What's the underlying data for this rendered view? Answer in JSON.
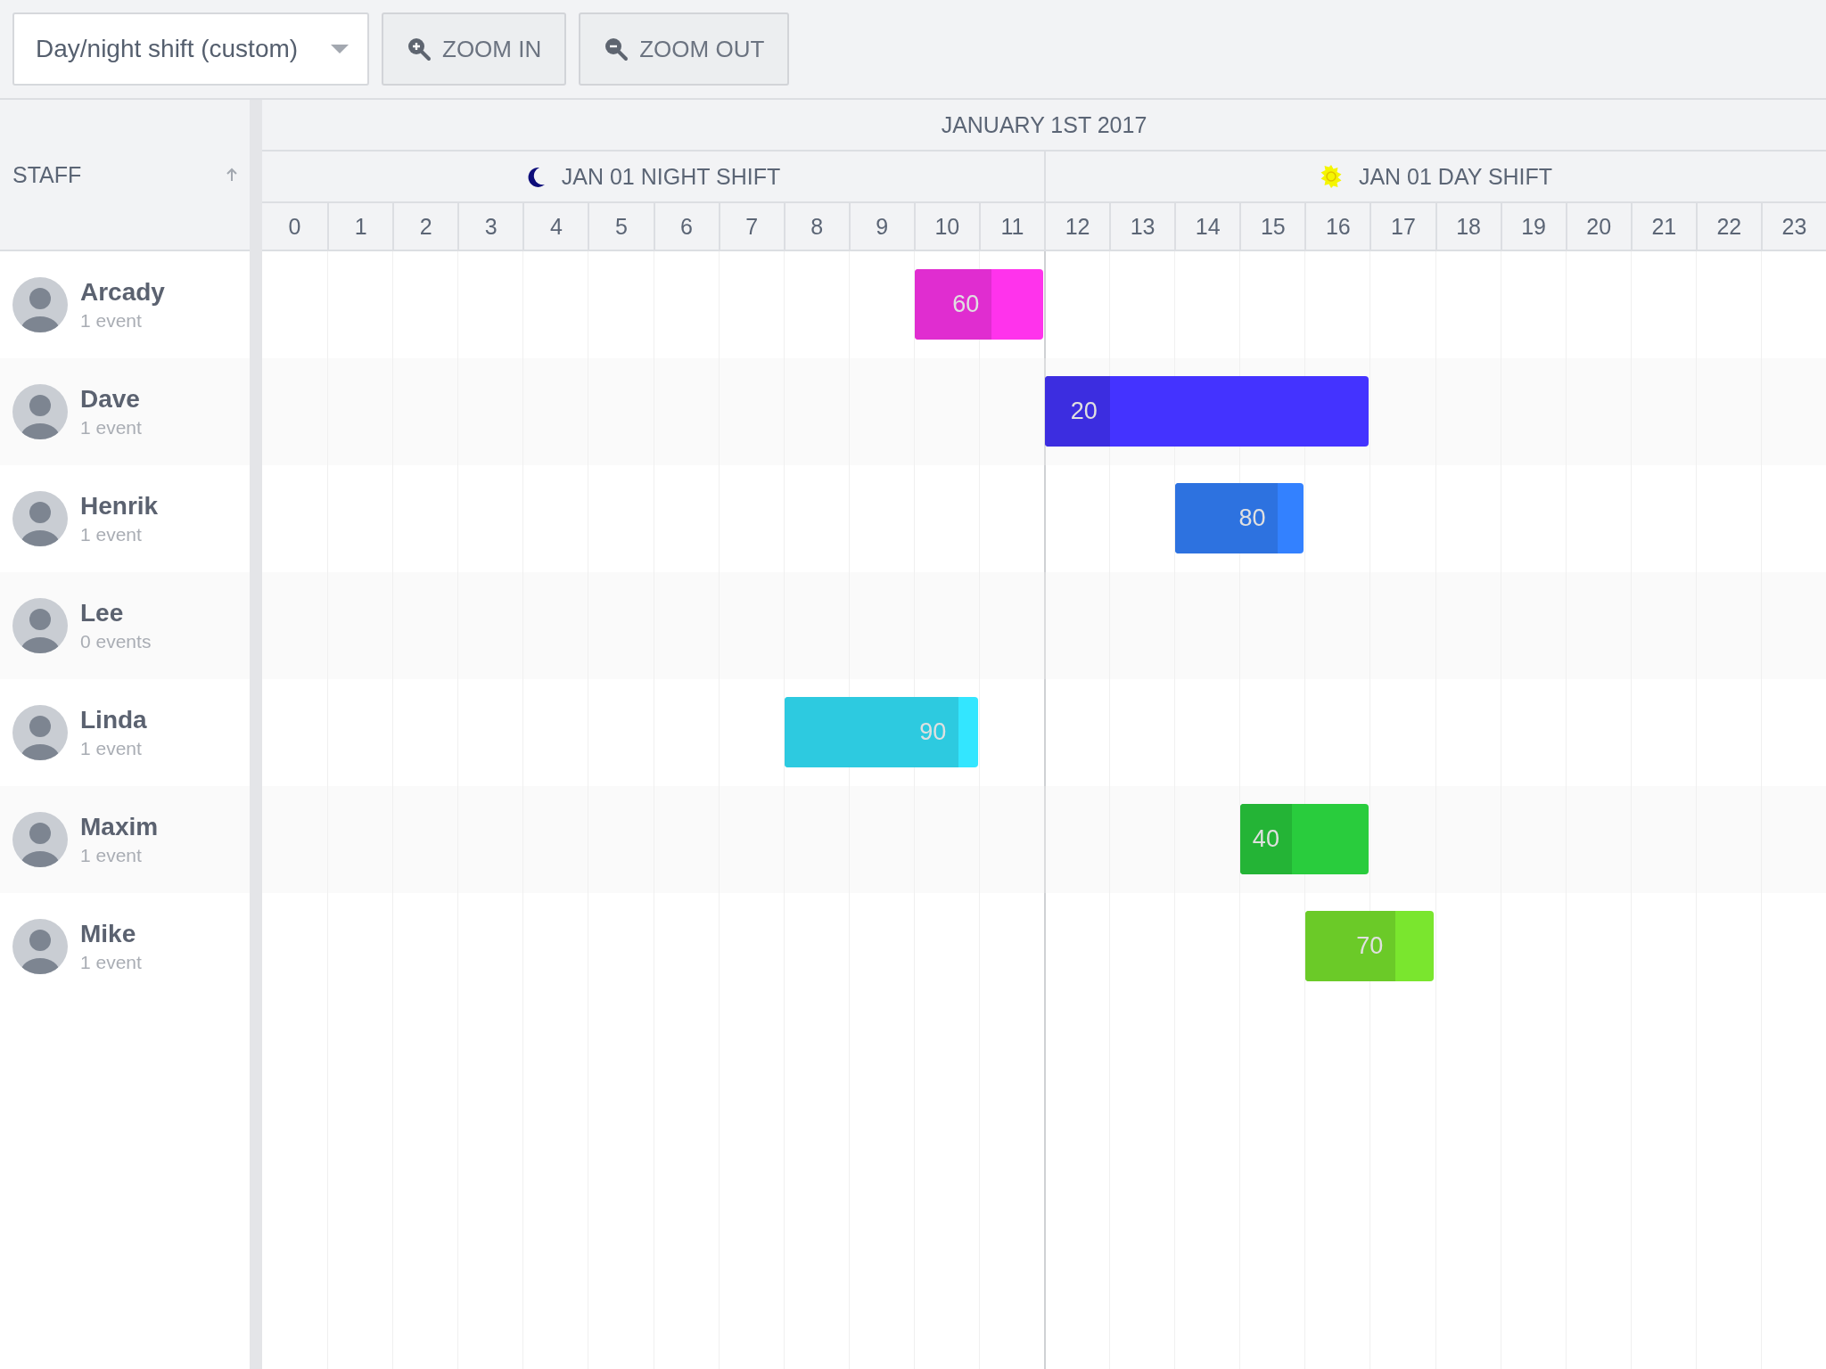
{
  "toolbar": {
    "preset": {
      "value": "Day/night shift (custom)"
    },
    "buttons": [
      {
        "kind": "zoom-in",
        "label": "ZOOM IN"
      },
      {
        "kind": "zoom-out",
        "label": "ZOOM OUT"
      }
    ]
  },
  "staff_column": {
    "label": "STAFF",
    "sorted_ascending": true
  },
  "timeline": {
    "date": "JANUARY 1ST 2017",
    "shifts": [
      {
        "kind": "night",
        "label": "JAN 01 NIGHT SHIFT"
      },
      {
        "kind": "day",
        "label": "JAN 01 DAY SHIFT"
      }
    ],
    "hours": [
      "0",
      "1",
      "2",
      "3",
      "4",
      "5",
      "6",
      "7",
      "8",
      "9",
      "10",
      "11",
      "12",
      "13",
      "14",
      "15",
      "16",
      "17",
      "18",
      "19",
      "20",
      "21",
      "22",
      "23"
    ]
  },
  "rows": [
    {
      "name": "Arcady",
      "events_count": "1 event",
      "events": [
        {
          "label": "60",
          "level": 0.6,
          "color": "#ff33ec"
        }
      ]
    },
    {
      "name": "Dave",
      "events_count": "1 event",
      "events": [
        {
          "label": "20",
          "level": 0.2,
          "color": "#4433ff"
        }
      ]
    },
    {
      "name": "Henrik",
      "events_count": "1 event",
      "events": [
        {
          "label": "80",
          "level": 0.8,
          "color": "#3381ff"
        }
      ]
    },
    {
      "name": "Lee",
      "events_count": "0 events"
    },
    {
      "name": "Linda",
      "events_count": "1 event",
      "events": [
        {
          "label": "90",
          "level": 0.9,
          "color": "#33e6ff"
        }
      ]
    },
    {
      "name": "Maxim",
      "events_count": "1 event",
      "events": [
        {
          "label": "40",
          "level": 0.4,
          "color": "#29cc3d"
        }
      ]
    },
    {
      "name": "Mike",
      "events_count": "1 event",
      "events": [
        {
          "label": "70",
          "level": 0.7,
          "color": "#7ae62e"
        }
      ]
    }
  ]
}
